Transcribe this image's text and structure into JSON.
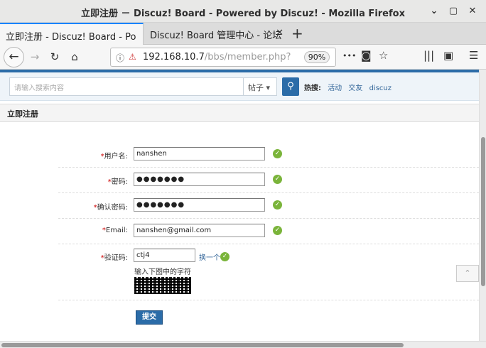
{
  "window": {
    "title": "立即注册 － Discuz! Board - Powered by Discuz! - Mozilla Firefox",
    "minimize": "⌄",
    "maximize": "▢",
    "close": "✕"
  },
  "tabs": [
    {
      "label": "立即注册 - Discuz! Board - Po",
      "close": "✕"
    },
    {
      "label": "Discuz! Board 管理中心 - 论坛",
      "close": "✕"
    }
  ],
  "new_tab": "+",
  "nav": {
    "url_host": "192.168.10.7",
    "url_path": "/bbs/member.php",
    "url_rest": "?",
    "zoom": "90%",
    "more": "•••"
  },
  "search": {
    "placeholder": "请输入搜索内容",
    "type": "帖子",
    "hot_label": "热搜:",
    "hot_links": [
      "活动",
      "交友",
      "discuz"
    ]
  },
  "section_title": "立即注册",
  "form": {
    "fields": [
      {
        "label": "用户名:",
        "value": "nanshen"
      },
      {
        "label": "密码:",
        "value": "●●●●●●●"
      },
      {
        "label": "确认密码:",
        "value": "●●●●●●●"
      },
      {
        "label": "Email:",
        "value": "nanshen@gmail.com"
      }
    ],
    "captcha_label": "验证码:",
    "captcha_value": "ctj4",
    "captcha_change": "换一个",
    "captcha_hint": "输入下图中的字符",
    "required_mark": "*",
    "check_mark": "✓",
    "submit": "提交"
  }
}
